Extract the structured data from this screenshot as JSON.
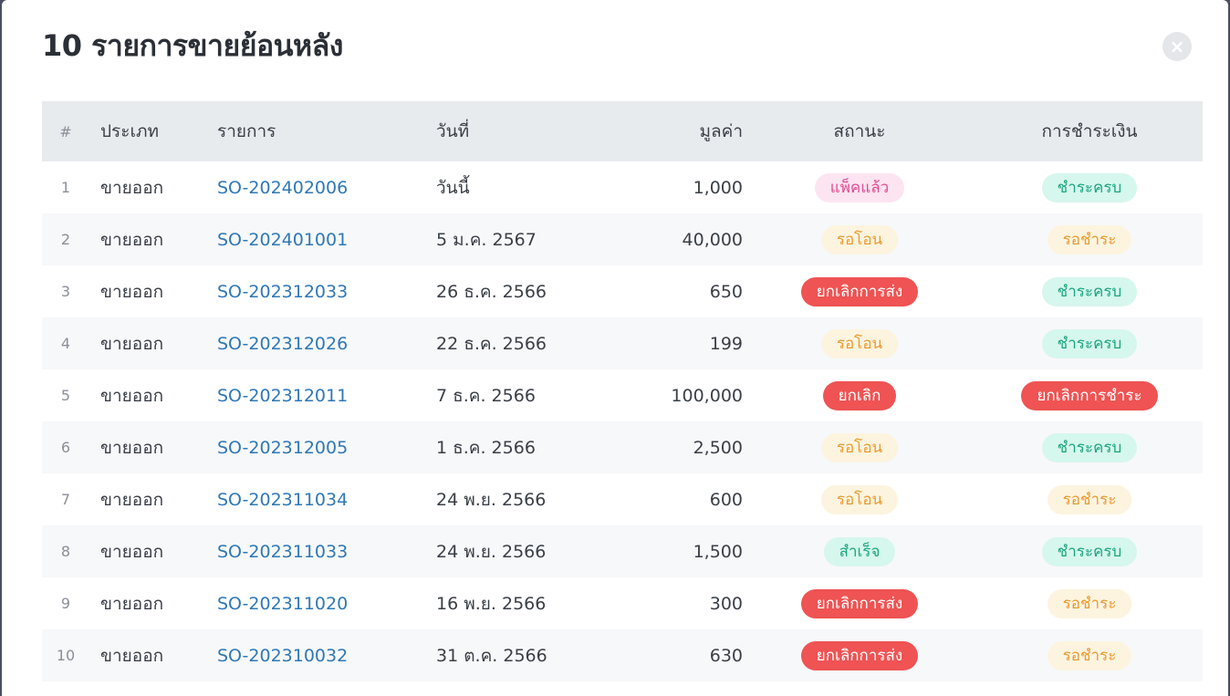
{
  "modal": {
    "title": "10 รายการขายย้อนหลัง",
    "close_icon": "×"
  },
  "table": {
    "headers": {
      "num": "#",
      "type": "ประเภท",
      "doc": "รายการ",
      "date": "วันที่",
      "amount": "มูลค่า",
      "status": "สถานะ",
      "payment": "การชำระเงิน"
    },
    "rows": [
      {
        "num": "1",
        "type": "ขายออก",
        "doc": "SO-202402006",
        "date": "วันนี้",
        "amount": "1,000",
        "status": "แพ็คแล้ว",
        "payment": "ชำระครบ"
      },
      {
        "num": "2",
        "type": "ขายออก",
        "doc": "SO-202401001",
        "date": "5 ม.ค. 2567",
        "amount": "40,000",
        "status": "รอโอน",
        "payment": "รอชำระ"
      },
      {
        "num": "3",
        "type": "ขายออก",
        "doc": "SO-202312033",
        "date": "26 ธ.ค. 2566",
        "amount": "650",
        "status": "ยกเลิกการส่ง",
        "payment": "ชำระครบ"
      },
      {
        "num": "4",
        "type": "ขายออก",
        "doc": "SO-202312026",
        "date": "22 ธ.ค. 2566",
        "amount": "199",
        "status": "รอโอน",
        "payment": "ชำระครบ"
      },
      {
        "num": "5",
        "type": "ขายออก",
        "doc": "SO-202312011",
        "date": "7 ธ.ค. 2566",
        "amount": "100,000",
        "status": "ยกเลิก",
        "payment": "ยกเลิกการชำระ"
      },
      {
        "num": "6",
        "type": "ขายออก",
        "doc": "SO-202312005",
        "date": "1 ธ.ค. 2566",
        "amount": "2,500",
        "status": "รอโอน",
        "payment": "ชำระครบ"
      },
      {
        "num": "7",
        "type": "ขายออก",
        "doc": "SO-202311034",
        "date": "24 พ.ย. 2566",
        "amount": "600",
        "status": "รอโอน",
        "payment": "รอชำระ"
      },
      {
        "num": "8",
        "type": "ขายออก",
        "doc": "SO-202311033",
        "date": "24 พ.ย. 2566",
        "amount": "1,500",
        "status": "สำเร็จ",
        "payment": "ชำระครบ"
      },
      {
        "num": "9",
        "type": "ขายออก",
        "doc": "SO-202311020",
        "date": "16 พ.ย. 2566",
        "amount": "300",
        "status": "ยกเลิกการส่ง",
        "payment": "รอชำระ"
      },
      {
        "num": "10",
        "type": "ขายออก",
        "doc": "SO-202310032",
        "date": "31 ต.ค. 2566",
        "amount": "630",
        "status": "ยกเลิกการส่ง",
        "payment": "รอชำระ"
      }
    ]
  },
  "colors": {
    "pink_badge_bg": "#fde4f1",
    "pink_badge_text": "#e0498f",
    "yellow_badge_bg": "#fdf4df",
    "yellow_badge_text": "#e99a30",
    "green_badge_bg": "#d6f7ee",
    "green_badge_text": "#1da57f",
    "red_badge_bg": "#ef5353",
    "link": "#2f78b5"
  }
}
